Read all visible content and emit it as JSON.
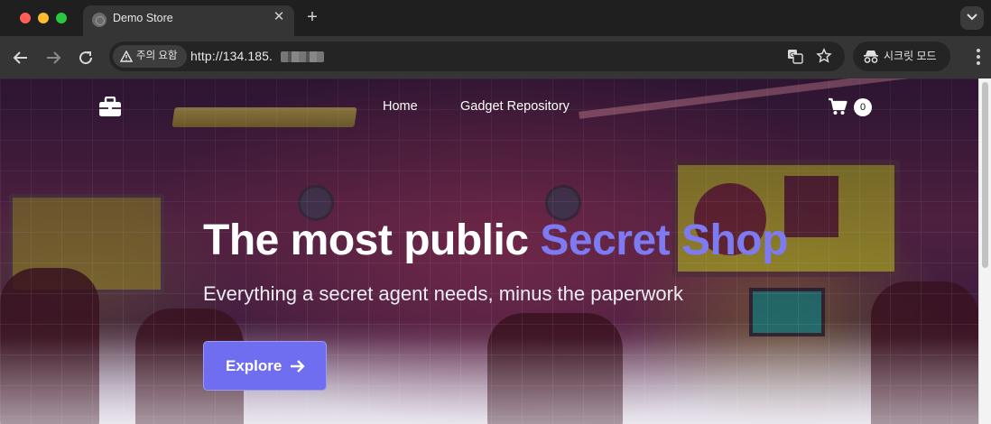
{
  "browser": {
    "tab_title": "Demo Store",
    "tab_close_icon": "close-icon",
    "new_tab_icon": "plus-icon",
    "security_label": "주의 요함",
    "url": "http://134.185.",
    "incognito_label": "시크릿 모드"
  },
  "site": {
    "nav": {
      "home": "Home",
      "repository": "Gadget Repository"
    },
    "cart_count": "0",
    "hero": {
      "title_main": "The most public ",
      "title_accent": "Secret Shop",
      "subtitle": "Everything a secret agent needs, minus the paperwork",
      "cta_label": "Explore"
    },
    "colors": {
      "accent": "#7e7af2",
      "button": "#6f6df0"
    }
  }
}
